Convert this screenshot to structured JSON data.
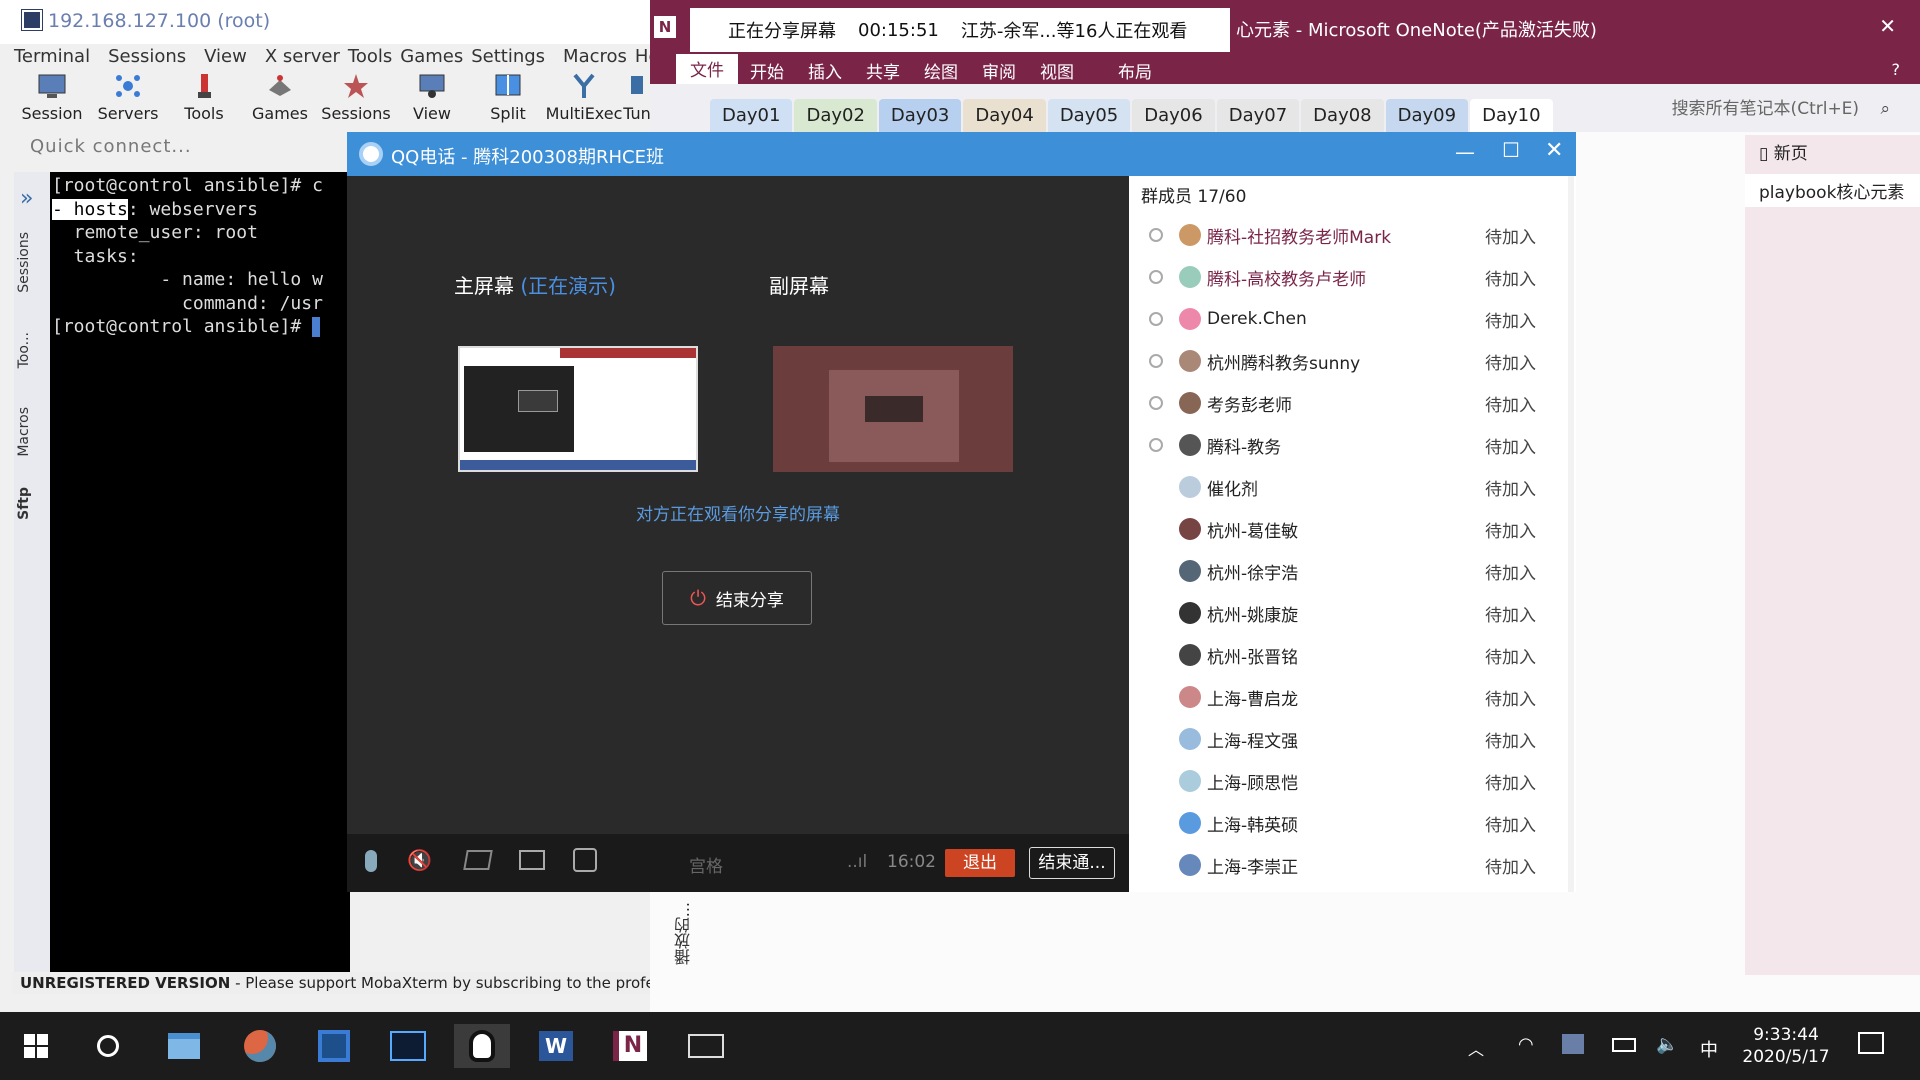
{
  "moba": {
    "title": "192.168.127.100 (root)",
    "menu": [
      "Terminal",
      "Sessions",
      "View",
      "X server",
      "Tools",
      "Games",
      "Settings",
      "Macros",
      "Help"
    ],
    "toolbar": [
      "Session",
      "Servers",
      "Tools",
      "Games",
      "Sessions",
      "View",
      "Split",
      "MultiExec",
      "Tun"
    ],
    "quick_connect": "Quick connect...",
    "side_tabs": [
      "Sessions",
      "Too...",
      "Macros",
      "Sftp"
    ],
    "terminal_lines": [
      "[root@control ansible]# c",
      "- hosts: webservers",
      "  remote_user: root",
      "  tasks:",
      "          - name: hello w",
      "            command: /usr",
      "[root@control ansible]# "
    ],
    "unregistered": "UNREGISTERED VERSION",
    "support_text": "-  Please support MobaXterm by subscribing to the profes"
  },
  "onenote": {
    "title": "心元素 - Microsoft OneNote(产品激活失败)",
    "ribbon": [
      "文件",
      "开始",
      "插入",
      "共享",
      "绘图",
      "审阅",
      "视图",
      "布局"
    ],
    "tabs": [
      "Day01",
      "Day02",
      "Day03",
      "Day04",
      "Day05",
      "Day06",
      "Day07",
      "Day08",
      "Day09",
      "Day10"
    ],
    "active_tab": "Day10",
    "search_placeholder": "搜索所有笔记本(Ctrl+E)",
    "new_page": "新页",
    "page_item": "playbook核心元素",
    "vertical_note": "播放的...",
    "colors": {
      "ribbon": "#7a2448",
      "tab_bg": "#efeff3"
    }
  },
  "share_banner": {
    "label": "正在分享屏幕",
    "timer": "00:15:51",
    "viewers": "江苏-余军...等16人正在观看"
  },
  "qq": {
    "title": "QQ电话 - 腾科200308期RHCE班",
    "main_screen": "主屏幕",
    "presenting": "(正在演示)",
    "sub_screen": "副屏幕",
    "watching": "对方正在观看你分享的屏幕",
    "end_share": "结束分享",
    "speaker": "宫格",
    "time": "16:02",
    "exit": "退出",
    "end_call": "结束通...",
    "members_header": "群成员 17/60",
    "members": [
      {
        "name": "腾科-社招教务老师Mark",
        "status": "待加入",
        "color": "#7a2448",
        "avatar": "#c96"
      },
      {
        "name": "腾科-高校教务卢老师",
        "status": "待加入",
        "color": "#7a2448",
        "avatar": "#9cb"
      },
      {
        "name": "Derek.Chen",
        "status": "待加入",
        "color": "#222",
        "avatar": "#e8a"
      },
      {
        "name": "杭州腾科教务sunny",
        "status": "待加入",
        "color": "#222",
        "avatar": "#a87"
      },
      {
        "name": "考务彭老师",
        "status": "待加入",
        "color": "#222",
        "avatar": "#865"
      },
      {
        "name": "腾科-教务",
        "status": "待加入",
        "color": "#222",
        "avatar": "#555"
      },
      {
        "name": "催化剂",
        "status": "待加入",
        "color": "#222",
        "avatar": "#bcd"
      },
      {
        "name": "杭州-葛佳敏",
        "status": "待加入",
        "color": "#222",
        "avatar": "#744"
      },
      {
        "name": "杭州-徐宇浩",
        "status": "待加入",
        "color": "#222",
        "avatar": "#567"
      },
      {
        "name": "杭州-姚康旋",
        "status": "待加入",
        "color": "#222",
        "avatar": "#333"
      },
      {
        "name": "杭州-张晋铭",
        "status": "待加入",
        "color": "#222",
        "avatar": "#444"
      },
      {
        "name": "上海-曹启龙",
        "status": "待加入",
        "color": "#222",
        "avatar": "#c88"
      },
      {
        "name": "上海-程文强",
        "status": "待加入",
        "color": "#222",
        "avatar": "#9bd"
      },
      {
        "name": "上海-顾思恺",
        "status": "待加入",
        "color": "#222",
        "avatar": "#acd"
      },
      {
        "name": "上海-韩英硕",
        "status": "待加入",
        "color": "#222",
        "avatar": "#5a9be0"
      },
      {
        "name": "上海-李崇正",
        "status": "待加入",
        "color": "#222",
        "avatar": "#68b"
      }
    ]
  },
  "taskbar": {
    "time": "9:33:44",
    "date": "2020/5/17",
    "ime": "中"
  }
}
